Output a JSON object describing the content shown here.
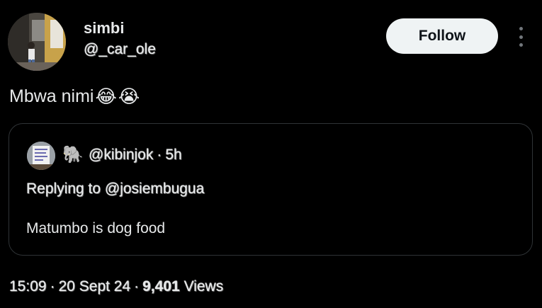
{
  "author": {
    "name": "simbi",
    "handle": "@_car_ole",
    "avatar_icon": "profile-photo"
  },
  "follow_label": "Follow",
  "more_icon": "more-vertical-icon",
  "tweet": {
    "text": "Mbwa nimi",
    "emoji_1": "😂",
    "emoji_2": "😭"
  },
  "quote": {
    "avatar_icon": "profile-photo",
    "badge_emoji": "🐘",
    "handle": "@kibinjok",
    "separator": "·",
    "time": "5h",
    "replying_to": "Replying to @josiembugua",
    "text": "Matumbo is dog food"
  },
  "meta": {
    "time": "15:09",
    "sep1": "·",
    "date": "20 Sept 24",
    "sep2": "·",
    "views_count": "9,401",
    "views_label": "Views"
  },
  "colors": {
    "background": "#000000",
    "text": "#e7e9ea",
    "follow_bg": "#eff3f4",
    "border": "#2f3336",
    "muted": "#71767b"
  }
}
